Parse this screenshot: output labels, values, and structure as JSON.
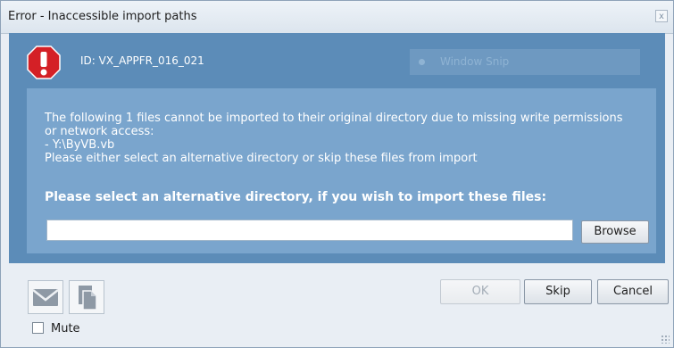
{
  "window": {
    "title": "Error - Inaccessible import paths",
    "close_label": "x"
  },
  "header": {
    "id_text": "ID: VX_APPFR_016_021",
    "snip_label": "Window Snip"
  },
  "message": {
    "lines": [
      "The following 1 files cannot be imported to their original directory due to missing write permissions",
      "or network access:",
      "- Y:\\ByVB.vb",
      "Please either select an alternative directory or skip these files from import"
    ],
    "instruction": "Please select an alternative directory, if you wish to import these files:"
  },
  "path_input": {
    "value": "",
    "placeholder": ""
  },
  "buttons": {
    "browse": "Browse",
    "ok": "OK",
    "skip": "Skip",
    "cancel": "Cancel"
  },
  "icons": {
    "error": "error-octagon-icon",
    "mail": "mail-icon",
    "copy": "copy-icon"
  },
  "mute": {
    "label": "Mute",
    "checked": false
  },
  "colors": {
    "panel_outer": "#5c8cb8",
    "panel_inner": "#7aa5cd",
    "error_red": "#d42026"
  }
}
